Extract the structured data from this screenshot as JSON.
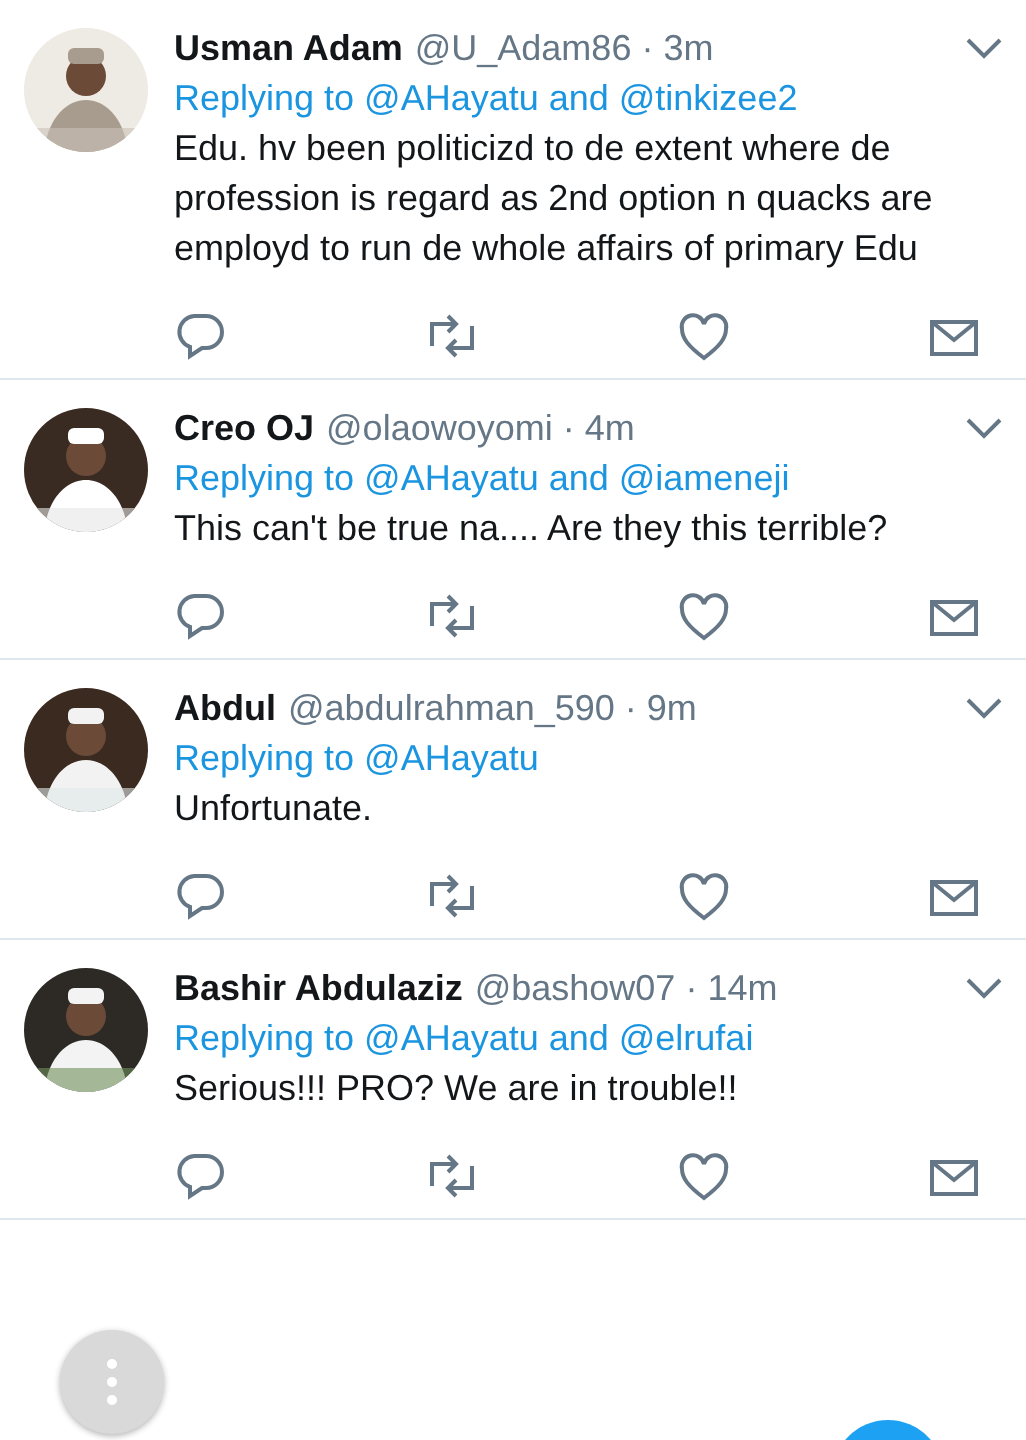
{
  "tweets": [
    {
      "name": "Usman Adam",
      "meta": "@U_Adam86 · 3m",
      "replying": "Replying to @AHayatu and @tinkizee2",
      "body": "Edu. hv been politicizd to de extent where de profession is regard as 2nd option n quacks are employd to run de whole affairs of primary Edu"
    },
    {
      "name": "Creo OJ",
      "meta": "@olaowoyomi · 4m",
      "replying": "Replying to @AHayatu and @iameneji",
      "body": "This can't be true na.... Are they this terrible?"
    },
    {
      "name": "Abdul",
      "meta": "@abdulrahman_590 · 9m",
      "replying": "Replying to @AHayatu",
      "body": "Unfortunate."
    },
    {
      "name": "Bashir Abdulaziz",
      "meta": "@bashow07 · 14m",
      "replying": "Replying to @AHayatu and @elrufai",
      "body": "Serious!!! PRO? We are in trouble!!"
    }
  ]
}
